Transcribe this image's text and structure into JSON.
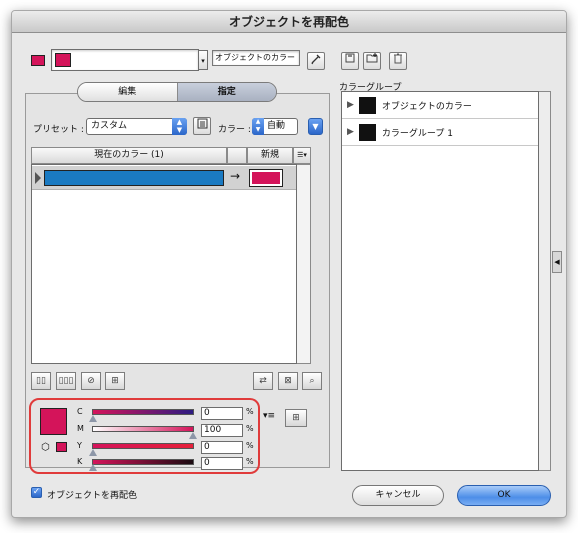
{
  "window": {
    "title": "オブジェクトを再配色"
  },
  "top": {
    "field_value": "オブジェクトのカラー",
    "colors": {
      "magenta": "#d4145a",
      "blue": "#1a7ac2"
    },
    "icons": [
      "eyedropper-icon",
      "save-icon",
      "new-group-icon",
      "trash-icon"
    ]
  },
  "tabs": [
    {
      "label": "編集",
      "active": false
    },
    {
      "label": "指定",
      "active": true
    }
  ],
  "preset": {
    "label": "プリセット :",
    "value": "カスタム",
    "color_label": "カラー :",
    "color_value": "自動"
  },
  "table": {
    "col_current": "現在のカラー (1)",
    "col_new": "新規",
    "rows": [
      {
        "current": "#1a7ac2",
        "new": "#d4145a"
      }
    ]
  },
  "cmyk": {
    "channels": [
      {
        "name": "C",
        "value": "0",
        "unit": "%"
      },
      {
        "name": "M",
        "value": "100",
        "unit": "%"
      },
      {
        "name": "Y",
        "value": "0",
        "unit": "%"
      },
      {
        "name": "K",
        "value": "0",
        "unit": "%"
      }
    ]
  },
  "color_groups": {
    "header": "カラーグループ",
    "items": [
      {
        "name": "オブジェクトのカラー"
      },
      {
        "name": "カラーグループ 1"
      }
    ]
  },
  "footer": {
    "checkbox_label": "オブジェクトを再配色",
    "checkbox_checked": true,
    "cancel_label": "キャンセル",
    "ok_label": "OK"
  }
}
